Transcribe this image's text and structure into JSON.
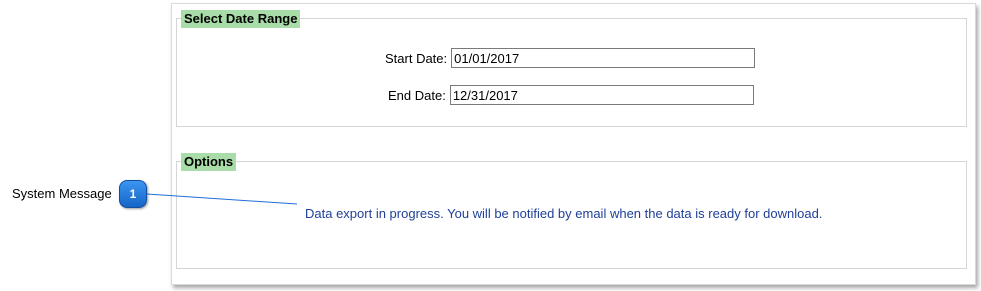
{
  "date_range": {
    "legend": "Select Date Range",
    "start_label": "Start Date:",
    "start_value": "01/01/2017",
    "end_label": "End Date:",
    "end_value": "12/31/2017"
  },
  "options": {
    "legend": "Options",
    "system_message": "Data export in progress. You will be notified by email when the data is ready for download."
  },
  "callout": {
    "label": "System Message",
    "number": "1",
    "color": "#1f6fd6"
  },
  "colors": {
    "legend_bg": "#a8dca8",
    "message_text": "#1f3f99"
  }
}
